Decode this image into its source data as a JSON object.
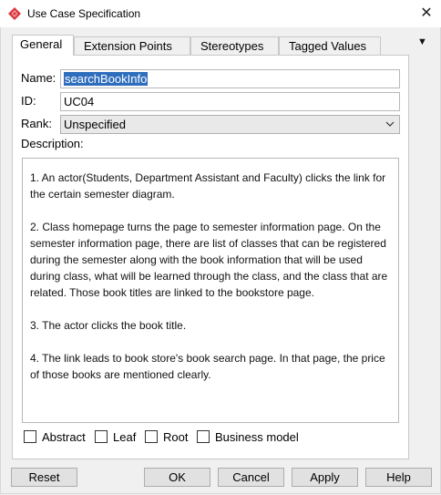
{
  "window": {
    "title": "Use Case Specification",
    "close_glyph": "✕",
    "icon": "visual-paradigm-icon"
  },
  "tabs": [
    {
      "label": "General",
      "active": true
    },
    {
      "label": "Extension Points",
      "active": false
    },
    {
      "label": "Stereotypes",
      "active": false
    },
    {
      "label": "Tagged Values",
      "active": false
    }
  ],
  "tab_menu_glyph": "▼",
  "form": {
    "name_label": "Name:",
    "name_value": "searchBookInfo",
    "id_label": "ID:",
    "id_value": "UC04",
    "rank_label": "Rank:",
    "rank_value": "Unspecified",
    "description_label": "Description:",
    "description_text": "1. An actor(Students, Department Assistant and Faculty) clicks the link for the certain semester diagram.\n\n2. Class homepage turns the page to semester information page. On the semester information page, there are list of classes that can be registered during the semester along with the book information that will be used during class, what will be learned through the class, and the class that are related. Those book titles are linked to the bookstore page.\n\n3. The actor clicks the book title.\n\n4. The link leads to book store's book search page. In that page, the price of those books are mentioned clearly."
  },
  "checkboxes": [
    {
      "label": "Abstract",
      "checked": false
    },
    {
      "label": "Leaf",
      "checked": false
    },
    {
      "label": "Root",
      "checked": false
    },
    {
      "label": "Business model",
      "checked": false
    }
  ],
  "buttons": {
    "reset": "Reset",
    "ok": "OK",
    "cancel": "Cancel",
    "apply": "Apply",
    "help": "Help"
  },
  "colors": {
    "selection": "#2f6ebd",
    "icon_red": "#d9363e"
  }
}
